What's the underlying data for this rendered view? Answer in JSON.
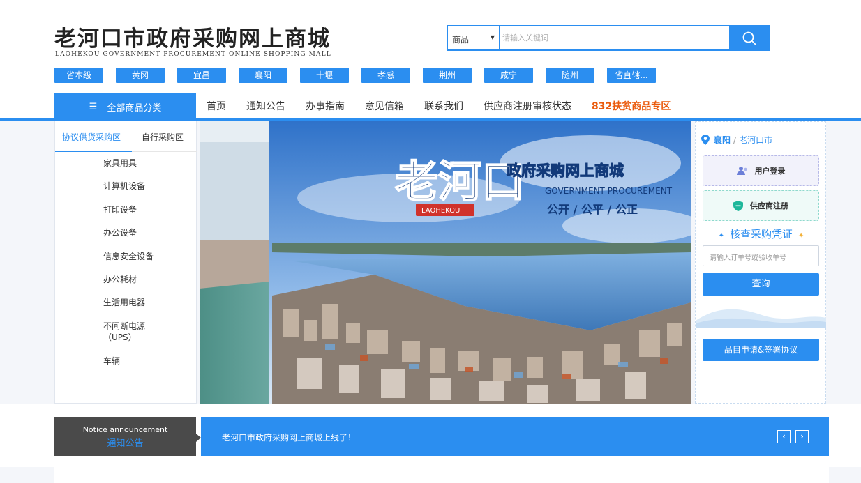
{
  "header": {
    "title": "老河口市政府采购网上商城",
    "subtitle": "LAOHEKOU GOVERNMENT PROCUREMENT ONLINE SHOPPING MALL"
  },
  "search": {
    "category": "商品",
    "placeholder": "请输入关键词",
    "button_icon": "search-icon"
  },
  "cities": [
    "省本级",
    "黄冈",
    "宜昌",
    "襄阳",
    "十堰",
    "孝感",
    "荆州",
    "咸宁",
    "随州",
    "省直辖..."
  ],
  "nav": {
    "all_categories": "全部商品分类",
    "links": [
      "首页",
      "通知公告",
      "办事指南",
      "意见信箱",
      "联系我们",
      "供应商注册审核状态"
    ],
    "hot_link": "832扶贫商品专区"
  },
  "left_panel": {
    "tabs": [
      "协议供货采购区",
      "自行采购区"
    ],
    "categories": [
      "家具用具",
      "计算机设备",
      "打印设备",
      "办公设备",
      "信息安全设备",
      "办公耗材",
      "生活用电器",
      "不间断电源",
      "（UPS）",
      "车辆"
    ]
  },
  "banner": {
    "big_chars": "老河口",
    "headline": "政府采购网上商城",
    "en_line": "GOVERNMENT PROCUREMENT",
    "slogan": "公开 / 公平 / 公正",
    "tag": "LAOHEKOU"
  },
  "right_panel": {
    "location_city": "襄阳",
    "location_sep": "/",
    "location_county": "老河口市",
    "login": "用户登录",
    "register": "供应商注册",
    "verify_title": "核查采购凭证",
    "verify_placeholder": "请输入订单号或验收单号",
    "verify_button": "查询",
    "apply_button": "品目申请&签署协议"
  },
  "notice": {
    "en": "Notice announcement",
    "cn": "通知公告",
    "text": "老河口市政府采购网上商城上线了！",
    "prev": "‹",
    "next": "›"
  },
  "colors": {
    "accent": "#2b8ef0",
    "hot": "#ea5a0c",
    "notice_head": "#4a4a4a"
  }
}
